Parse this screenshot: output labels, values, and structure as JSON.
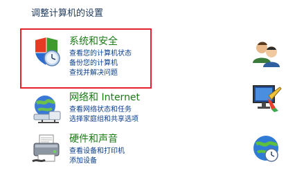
{
  "header": {
    "title": "调整计算机的设置"
  },
  "categories": [
    {
      "title": "系统和安全",
      "icon": "shield-clock-icon",
      "links": [
        "查看您的计算机状态",
        "备份您的计算机",
        "查找并解决问题"
      ]
    },
    {
      "title": "网络和 Internet",
      "icon": "network-icon",
      "links": [
        "查看网络状态和任务",
        "选择家庭组和共享选项"
      ]
    },
    {
      "title": "硬件和声音",
      "icon": "printer-icon",
      "links": [
        "查看设备和打印机",
        "添加设备"
      ]
    }
  ],
  "right_icons": [
    "user-accounts-icon",
    "appearance-icon",
    "clock-globe-icon"
  ],
  "colors": {
    "highlight": "#e8202a",
    "category_title": "#1a7a14",
    "link": "#0a3e8c",
    "header": "#1e395b"
  }
}
